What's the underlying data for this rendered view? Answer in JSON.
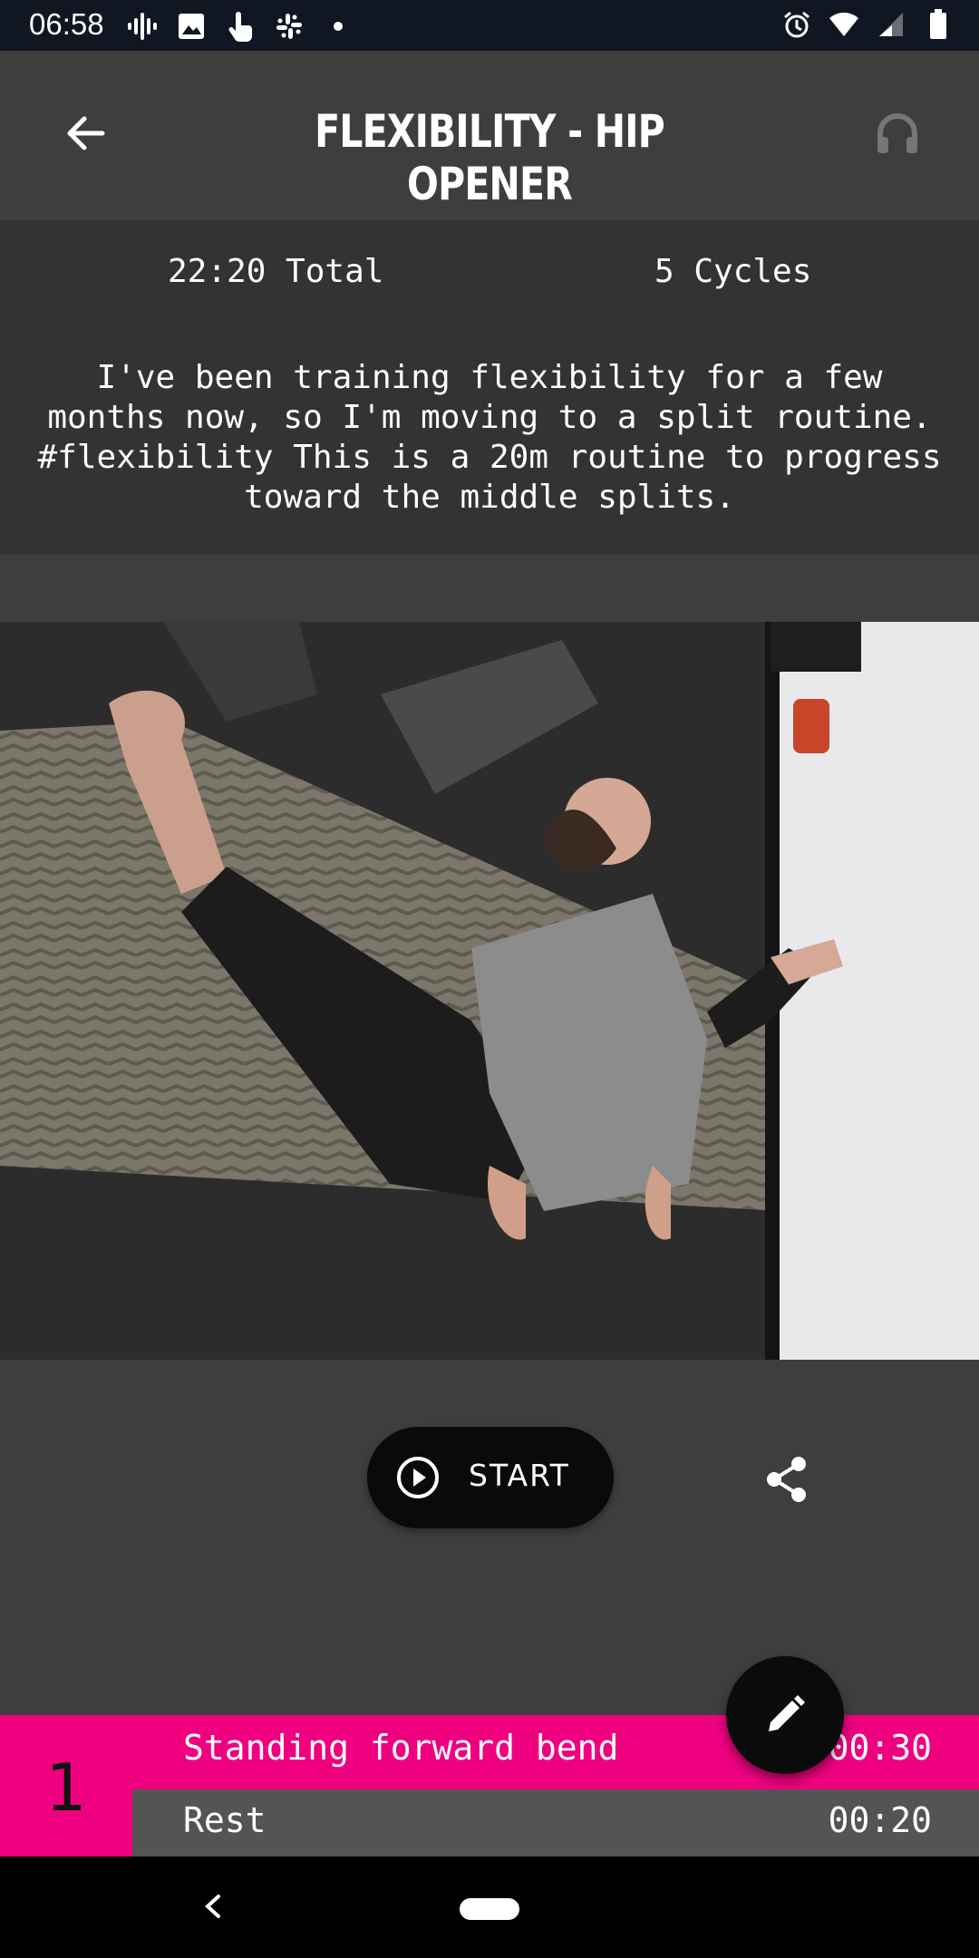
{
  "status_bar": {
    "time": "06:58",
    "left_icons": [
      "podcast-icon",
      "image-icon",
      "touch-icon",
      "slack-icon",
      "dot-icon"
    ],
    "right_icons": [
      "alarm-icon",
      "wifi-icon",
      "signal-icon",
      "battery-icon"
    ]
  },
  "header": {
    "title": "FLEXIBILITY - HIP OPENER",
    "back_icon": "arrow-left-icon",
    "audio_icon": "headphones-icon"
  },
  "summary": {
    "total": "22:20 Total",
    "cycles": "5 Cycles",
    "description": "I've been training flexibility for a few months now, so I'm moving to a split routine. #flexibility This is a 20m routine to progress toward the middle splits."
  },
  "actions": {
    "start_label": "START",
    "start_icon": "play-circle-icon",
    "share_icon": "share-icon",
    "edit_icon": "pencil-icon"
  },
  "exercises": [
    {
      "number": "1",
      "name": "Standing forward bend",
      "time": "00:30",
      "rest_label": "Rest",
      "rest_time": "00:20"
    }
  ],
  "colors": {
    "accent": "#ee007f",
    "background": "#3e3e3f",
    "panel": "#333334",
    "rest_row": "#545455"
  }
}
